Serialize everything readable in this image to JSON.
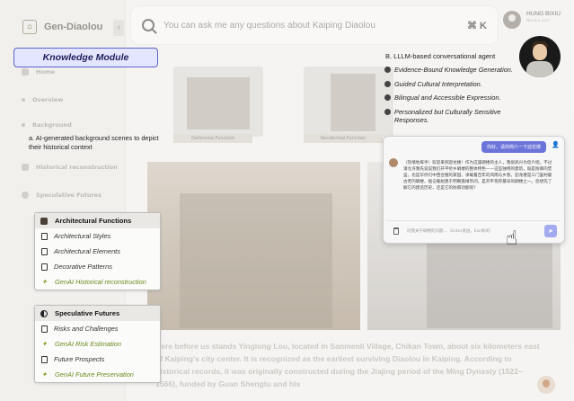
{
  "app": {
    "brand": "Gen-Diaolou",
    "collapse_glyph": "‹"
  },
  "search": {
    "placeholder": "You can ask me any questions about Kaiping Diaolou",
    "shortcut": "⌘ K"
  },
  "user": {
    "name": "HUNG BIXIU",
    "role": "Novice user"
  },
  "sidebar": {
    "items": [
      {
        "label": "Home",
        "icon": "home-icon"
      },
      {
        "label": "Overview",
        "icon": "dot-icon"
      },
      {
        "label": "Background",
        "icon": "dot-icon"
      },
      {
        "label": "Historical reconstruction",
        "icon": "building-icon"
      },
      {
        "label": "Speculative Futures",
        "icon": "half-circle-icon"
      }
    ]
  },
  "gallery": {
    "labels": [
      "Defensive Function",
      "Residential Function"
    ]
  },
  "annotations": {
    "knowledge_module": "Knowledge Module",
    "a_caption": "a. AI-generated background scenes to depict their historical context",
    "b_title": "B. LLLM-based conversational agent",
    "features": [
      "Evidence-Bound Knowledge Generation.",
      "Guided Cultural Interpretation.",
      "Bilingual and Accessible Expression.",
      "Personalized but Culturally Sensitive Responses."
    ]
  },
  "chat": {
    "user_message": "你好，请你简介一下迎龙楼",
    "agent_answer": "（热情地挥手）欢迎来到迎龙楼！作为这座碉楼的主人，我很高兴为您介绍。不过请允许我先说说我们开平侨乡碉楼的整体特色——这些独特的建筑，既是防御的堡垒，也是华侨们中西合璧的家园，承载着百年的风雨与乡愁。迎龙楼是三门里村最古老的碉楼，据记载始建于明朝嘉靖年间，是开平现存最早的碉楼之一。您想先了解它的建造历史，还是它的防御功能呢？",
    "input_placeholder": "问我关于碉楼的问题...（Enter发送，Esc关闭）"
  },
  "modules": {
    "architectural": {
      "title": "Architectural Functions",
      "items": [
        {
          "label": "Architectural Styles",
          "ai": false
        },
        {
          "label": "Architectural Elements",
          "ai": false
        },
        {
          "label": "Decorative Patterns",
          "ai": false
        },
        {
          "label": "GenAI Historical reconstruction",
          "ai": true
        }
      ]
    },
    "speculative": {
      "title": "Speculative Futures",
      "items": [
        {
          "label": "Risks and Challenges",
          "ai": false
        },
        {
          "label": "GenAI Risk Estimation",
          "ai": true
        },
        {
          "label": "Future Prospects",
          "ai": false
        },
        {
          "label": "GenAI Future Preservation",
          "ai": true
        }
      ]
    }
  },
  "article": {
    "text": "Here before us stands Yinglong Lou, located in Sanmenli Village, Chikan Town, about six kilometers east of Kaiping's city center. It is recognized as the earliest surviving Diaolou in Kaiping. According to historical records, it was originally constructed during the Jiajing period of the Ming Dynasty (1522–1566), funded by Guan Shengtu and his"
  },
  "colors": {
    "accent": "#5b63c9",
    "genai_green": "#6b8a1c",
    "send_button": "#a4aaf0"
  }
}
